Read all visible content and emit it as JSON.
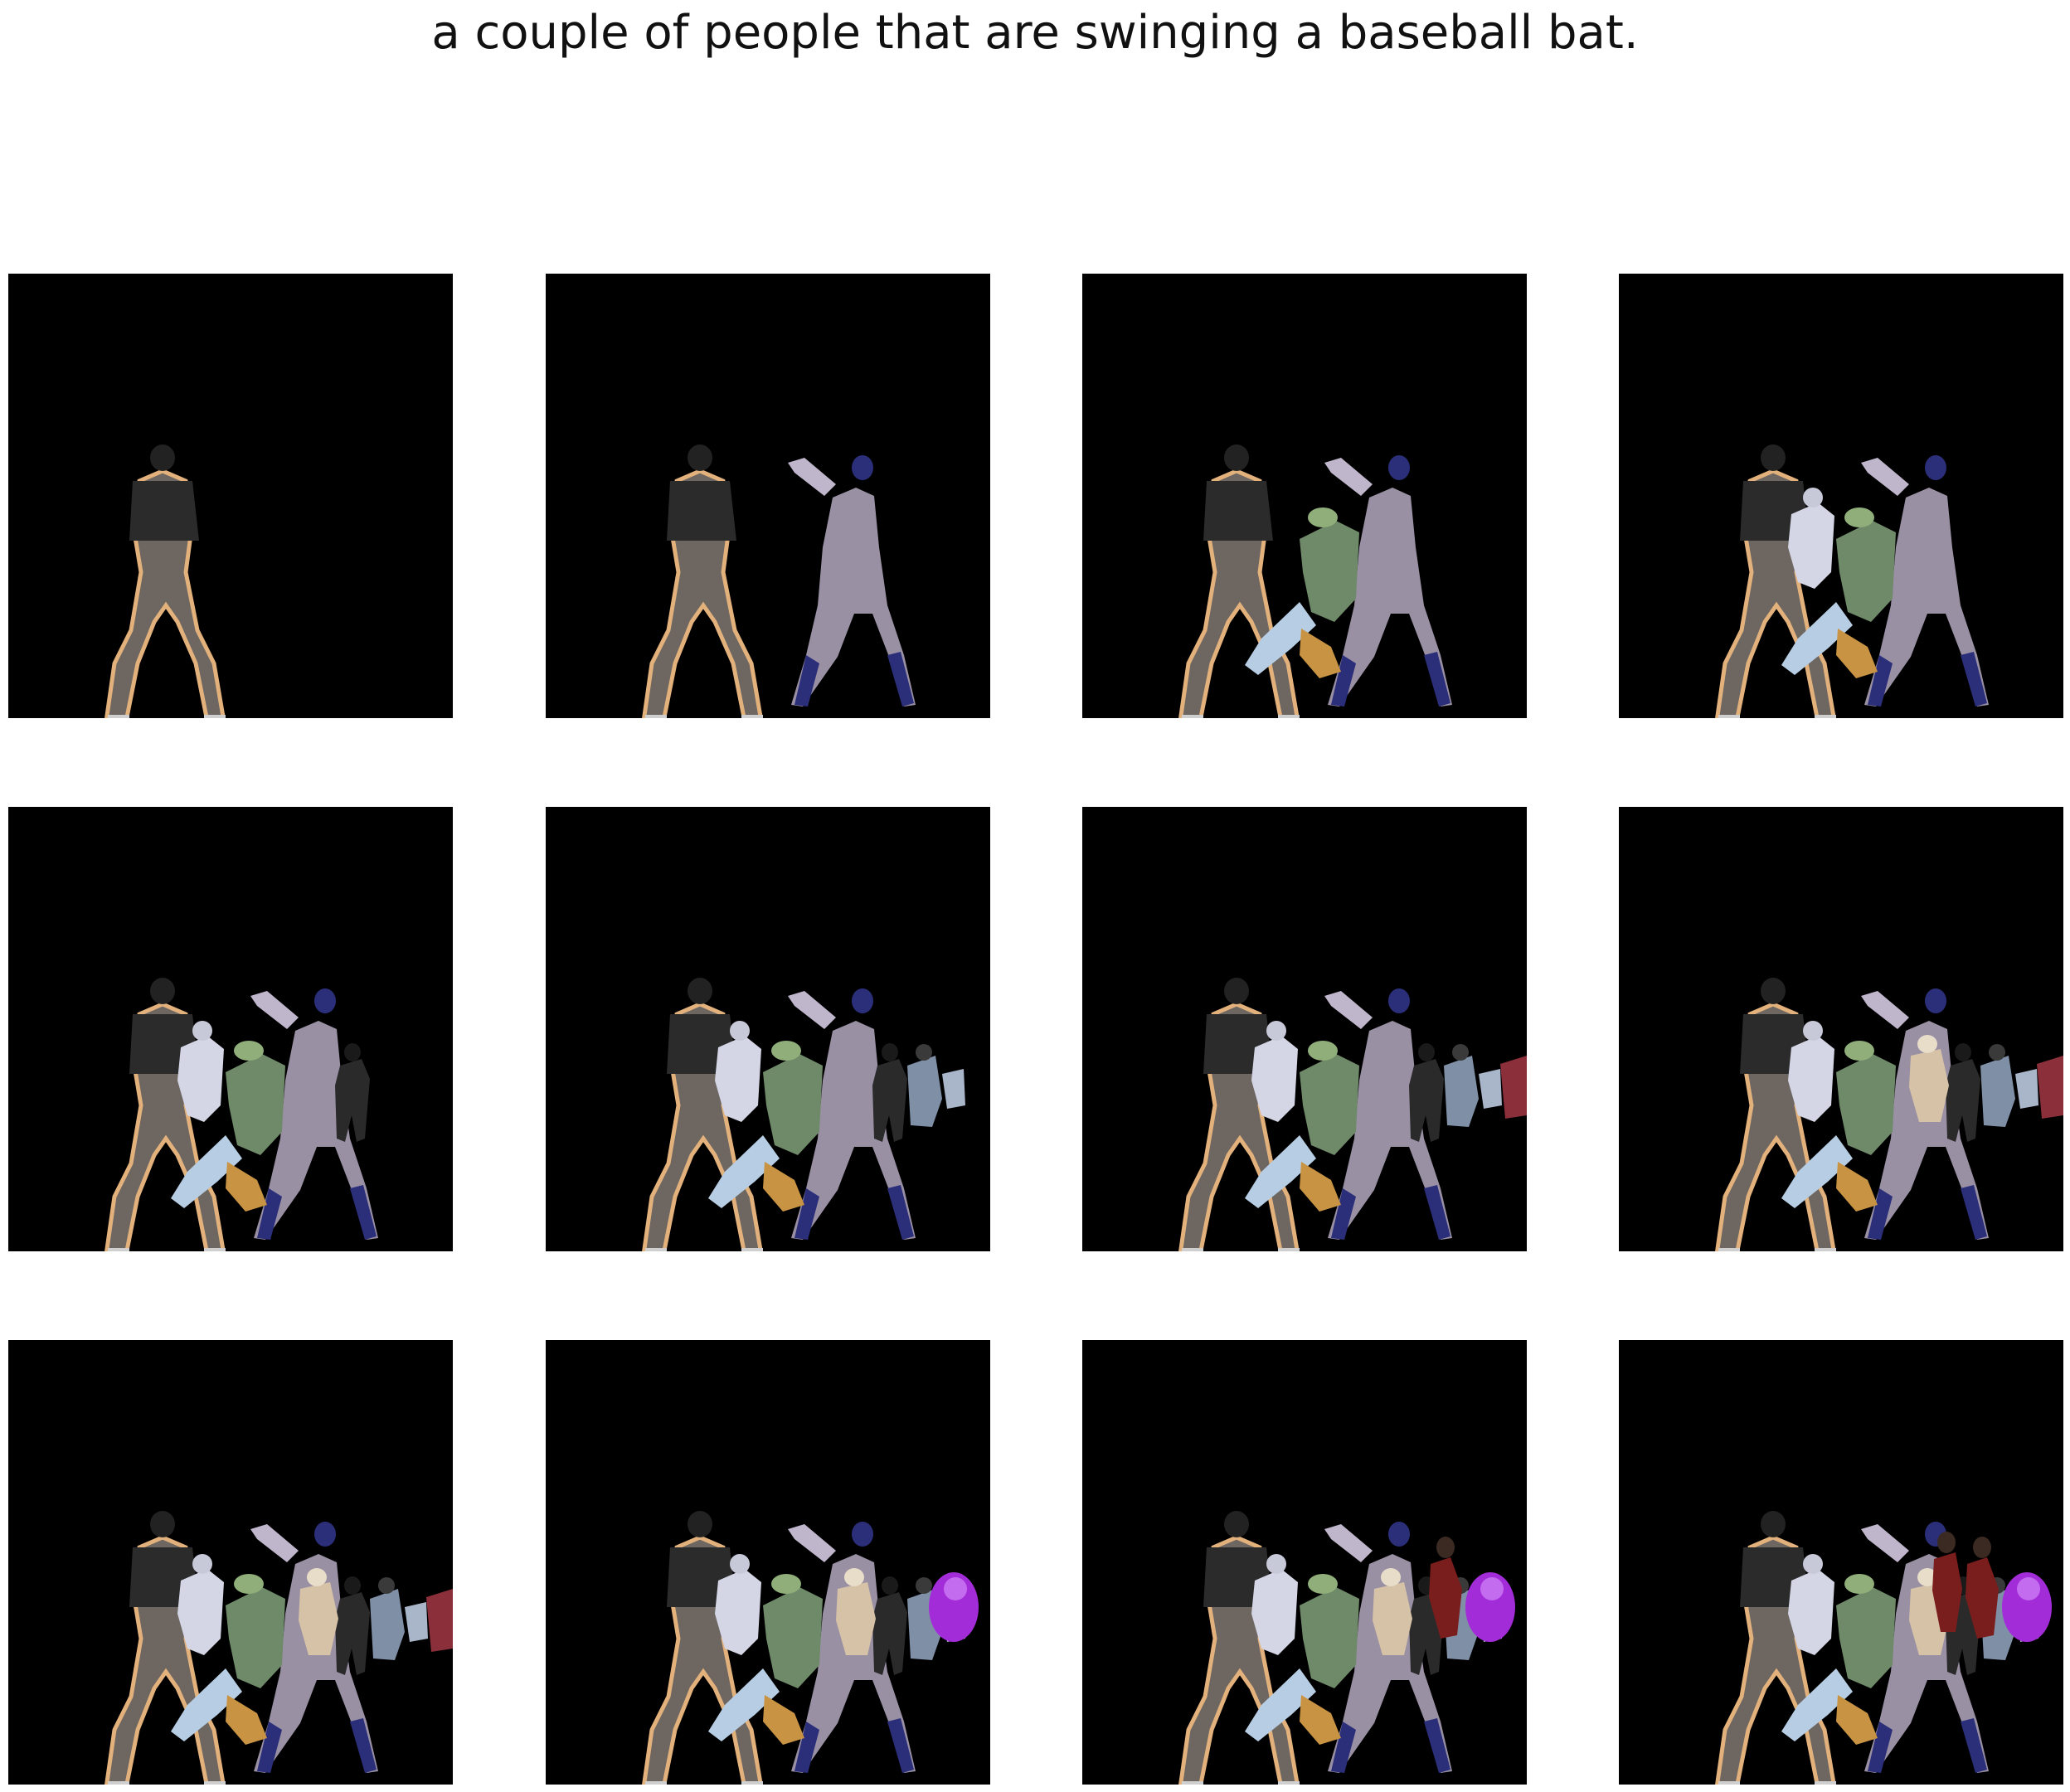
{
  "caption": "a couple of people that are swinging a baseball bat.",
  "figure": {
    "rows": 3,
    "columns": 4,
    "panel_background": "#000000",
    "page_background": "#ffffff",
    "panels": [
      {
        "objects": [
          "umpire"
        ]
      },
      {
        "objects": [
          "umpire",
          "batter"
        ]
      },
      {
        "objects": [
          "umpire",
          "batter",
          "catcher"
        ]
      },
      {
        "objects": [
          "umpire",
          "batter",
          "catcher",
          "player-white"
        ]
      },
      {
        "objects": [
          "umpire",
          "batter",
          "catcher",
          "player-white",
          "spectator-dark"
        ]
      },
      {
        "objects": [
          "umpire",
          "batter",
          "catcher",
          "player-white",
          "spectator-dark",
          "spectator-group"
        ]
      },
      {
        "objects": [
          "umpire",
          "batter",
          "catcher",
          "player-white",
          "spectator-dark",
          "spectator-group",
          "spectator-red-edge"
        ]
      },
      {
        "objects": [
          "umpire",
          "batter",
          "catcher",
          "player-white",
          "spectator-dark",
          "spectator-group",
          "spectator-red-edge",
          "spectator-cream"
        ]
      },
      {
        "objects": [
          "umpire",
          "batter",
          "catcher",
          "player-white",
          "spectator-dark",
          "spectator-group",
          "spectator-red-edge",
          "spectator-cream"
        ]
      },
      {
        "objects": [
          "umpire",
          "batter",
          "catcher",
          "player-white",
          "spectator-dark",
          "spectator-group",
          "spectator-cream",
          "purple-blob"
        ]
      },
      {
        "objects": [
          "umpire",
          "batter",
          "catcher",
          "player-white",
          "spectator-dark",
          "spectator-group",
          "spectator-cream",
          "purple-blob",
          "spectator-red-standing"
        ]
      },
      {
        "objects": [
          "umpire",
          "batter",
          "catcher",
          "player-white",
          "spectator-dark",
          "spectator-group",
          "spectator-cream",
          "purple-blob",
          "spectator-red-standing",
          "spectator-red-pair"
        ]
      }
    ]
  }
}
